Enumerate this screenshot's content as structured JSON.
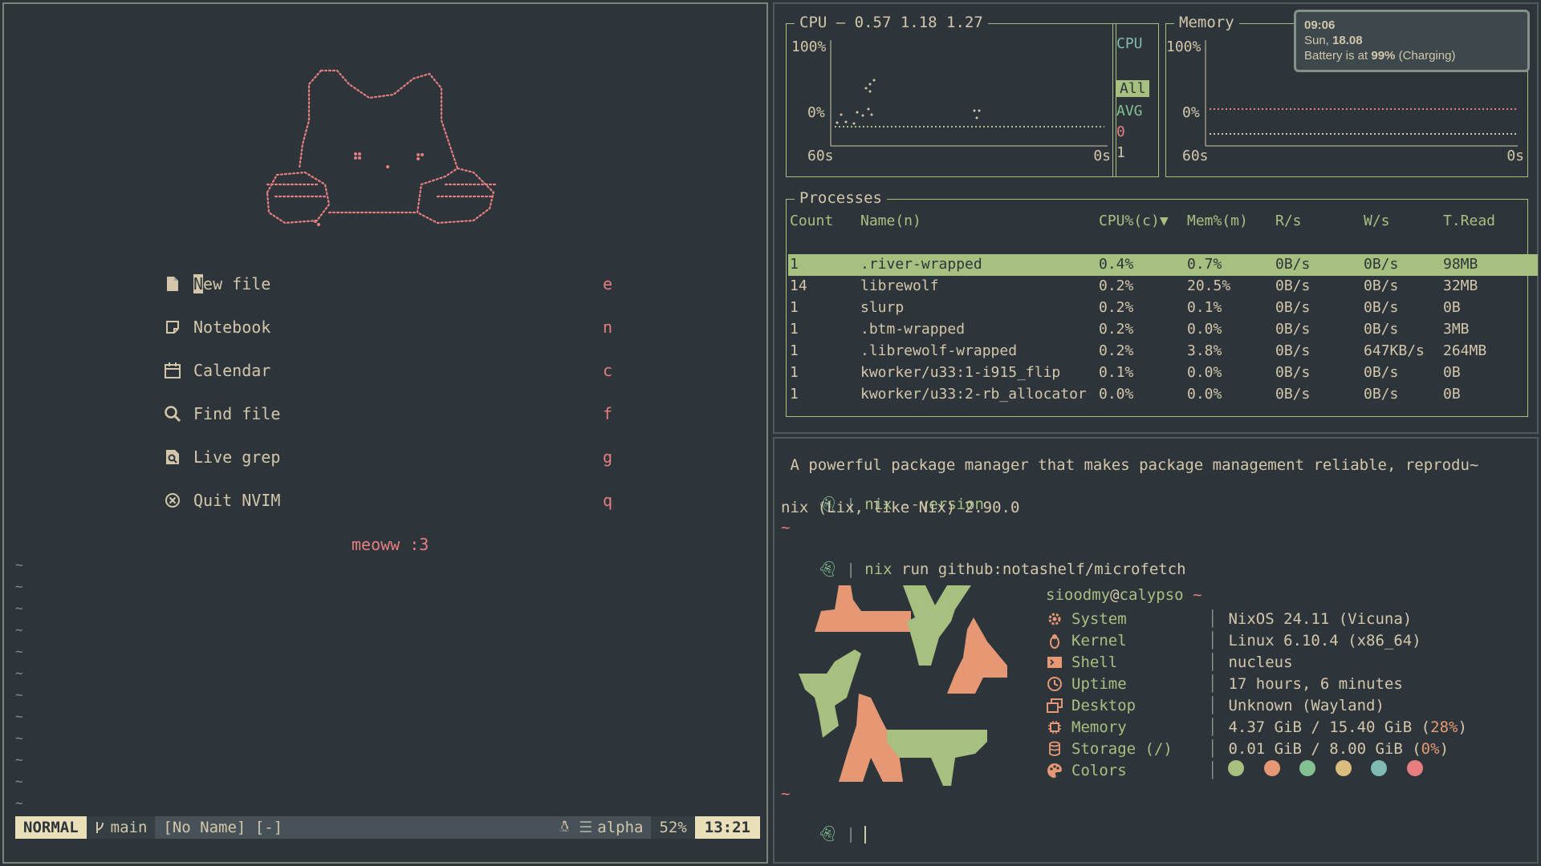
{
  "nvim": {
    "menu": [
      {
        "icon": "file-icon",
        "label": "New file",
        "key": "e"
      },
      {
        "icon": "notebook-icon",
        "label": "Notebook",
        "key": "n"
      },
      {
        "icon": "calendar-icon",
        "label": "Calendar",
        "key": "c"
      },
      {
        "icon": "search-icon",
        "label": "Find file",
        "key": "f"
      },
      {
        "icon": "grep-icon",
        "label": "Live grep",
        "key": "g"
      },
      {
        "icon": "quit-icon",
        "label": "Quit NVIM",
        "key": "q"
      }
    ],
    "footer": "meoww :3",
    "tilde": "~",
    "statusline": {
      "mode": "NORMAL",
      "branch": "main",
      "filename": "[No Name] [-]",
      "filetype": "alpha",
      "percent": "52%",
      "time": "13:21"
    }
  },
  "btm": {
    "cpu": {
      "title": "CPU — 0.57 1.18 1.27",
      "y_max": "100%",
      "y_min": "0%",
      "x_left": "60s",
      "x_right": "0s"
    },
    "cpu_legend": {
      "title": "CPU",
      "items": [
        "All",
        "AVG",
        "0",
        "1"
      ]
    },
    "memory": {
      "title": "Memory",
      "y_max": "100%",
      "y_min": "0%",
      "x_left": "60s",
      "x_right": "0s"
    },
    "processes": {
      "title": "Processes",
      "headers": [
        "Count",
        "Name(n)",
        "CPU%(c)▼",
        "Mem%(m)",
        "R/s",
        "W/s",
        "T.Read"
      ],
      "rows": [
        [
          "1",
          ".river-wrapped",
          "0.4%",
          "0.7%",
          "0B/s",
          "0B/s",
          "98MB"
        ],
        [
          "14",
          "librewolf",
          "0.2%",
          "20.5%",
          "0B/s",
          "0B/s",
          "32MB"
        ],
        [
          "1",
          "slurp",
          "0.2%",
          "0.1%",
          "0B/s",
          "0B/s",
          "0B"
        ],
        [
          "1",
          ".btm-wrapped",
          "0.2%",
          "0.0%",
          "0B/s",
          "0B/s",
          "3MB"
        ],
        [
          "1",
          ".librewolf-wrapped",
          "0.2%",
          "3.8%",
          "0B/s",
          "647KB/s",
          "264MB"
        ],
        [
          "1",
          "kworker/u33:1-i915_flip",
          "0.1%",
          "0.0%",
          "0B/s",
          "0B/s",
          "0B"
        ],
        [
          "1",
          "kworker/u33:2-rb_allocator",
          "0.0%",
          "0.0%",
          "0B/s",
          "0B/s",
          "0B"
        ]
      ]
    }
  },
  "notification": {
    "time": "09:06",
    "day": "Sun,",
    "date": "18.08",
    "battery_prefix": "Battery is at",
    "battery_level": "99%",
    "battery_suffix": "(Charging)"
  },
  "terminal": {
    "desc_line": " A powerful package manager that makes package management reliable, reprodu~",
    "prompt_sep": "|",
    "cmd1": "nix --version",
    "out1": "nix (Lix, like Nix) 2.90.0",
    "tilde": "~",
    "cmd2": "nix run github:notashelf/microfetch",
    "user": "sioodmy",
    "at": "@",
    "host": "calypso",
    "home": "~",
    "info": [
      {
        "icon": "gear-icon",
        "key": "System",
        "value": "NixOS 24.11 (Vicuna)"
      },
      {
        "icon": "linux-icon",
        "key": "Kernel",
        "value": "Linux 6.10.4 (x86_64)"
      },
      {
        "icon": "terminal-icon",
        "key": "Shell",
        "value": "nucleus"
      },
      {
        "icon": "clock-icon",
        "key": "Uptime",
        "value": "17 hours, 6 minutes"
      },
      {
        "icon": "desktop-icon",
        "key": "Desktop",
        "value": "Unknown (Wayland)"
      },
      {
        "icon": "chip-icon",
        "key": "Memory",
        "value_main": "4.37 GiB / 15.40 GiB (",
        "value_pct": "28%",
        "value_end": ")"
      },
      {
        "icon": "database-icon",
        "key": "Storage (/)",
        "value_main": "0.01 GiB / 8.00 GiB (",
        "value_pct": "0%",
        "value_end": ")"
      },
      {
        "icon": "palette-icon",
        "key": "Colors"
      }
    ],
    "colors": [
      "#a7c080",
      "#e69875",
      "#83c092",
      "#dbbc7f",
      "#7fbbb3",
      "#e67e80"
    ],
    "accent_green": "#a7c080",
    "accent_orange": "#e69875"
  }
}
